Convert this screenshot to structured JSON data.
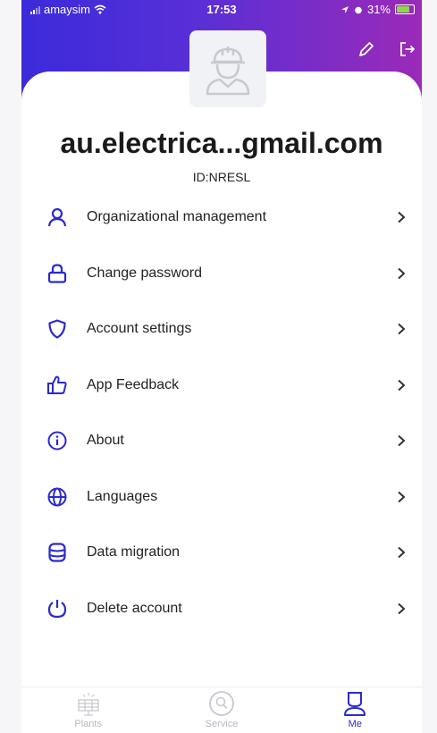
{
  "status_bar": {
    "carrier": "amaysim",
    "time": "17:53",
    "battery": "31%"
  },
  "user": {
    "name": "au.electrica...gmail.com",
    "id_text": "ID:NRESL"
  },
  "menu": {
    "items": [
      {
        "label": "Organizational management",
        "icon": "person-icon"
      },
      {
        "label": "Change password",
        "icon": "lock-icon"
      },
      {
        "label": "Account settings",
        "icon": "shield-icon"
      },
      {
        "label": "App Feedback",
        "icon": "thumbs-up-icon"
      },
      {
        "label": "About",
        "icon": "info-icon"
      },
      {
        "label": "Languages",
        "icon": "globe-icon"
      },
      {
        "label": "Data migration",
        "icon": "database-icon"
      },
      {
        "label": "Delete account",
        "icon": "power-icon"
      }
    ]
  },
  "tabbar": {
    "tabs": [
      {
        "label": "Plants",
        "active": false
      },
      {
        "label": "Service",
        "active": false
      },
      {
        "label": "Me",
        "active": true
      }
    ]
  },
  "colors": {
    "accent": "#2a2ad0",
    "header_gradient_start": "#3b2bdb",
    "header_gradient_end": "#9b2ab8",
    "inactive_tab": "#b8b8c2"
  }
}
